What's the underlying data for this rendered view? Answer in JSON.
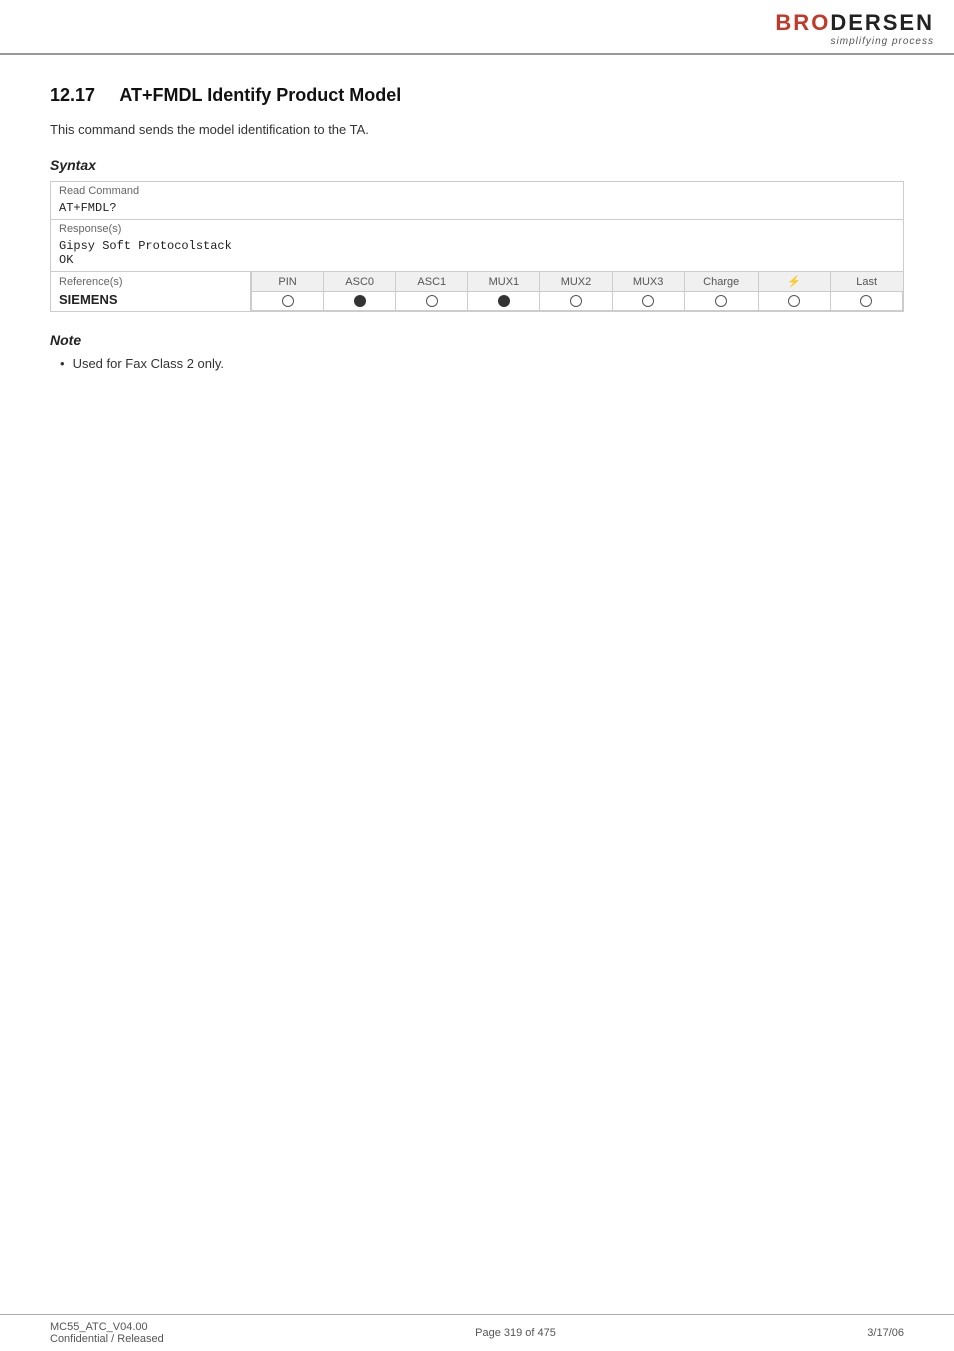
{
  "header": {
    "logo_text": "BRODERSEN",
    "logo_tagline": "simplifying process"
  },
  "section": {
    "number": "12.17",
    "title": "AT+FMDL   Identify Product Model",
    "description": "This command sends the model identification to the TA."
  },
  "syntax": {
    "label": "Syntax",
    "read_command_label": "Read Command",
    "read_command_value": "AT+FMDL?",
    "response_label": "Response(s)",
    "response_value": "Gipsy Soft Protocolstack\nOK",
    "reference_label": "Reference(s)",
    "columns": [
      "PIN",
      "ASC0",
      "ASC1",
      "MUX1",
      "MUX2",
      "MUX3",
      "Charge",
      "⚡",
      "Last"
    ],
    "rows": [
      {
        "name": "SIEMENS",
        "values": [
          "empty",
          "filled",
          "empty",
          "filled",
          "empty",
          "empty",
          "empty",
          "empty",
          "empty"
        ]
      }
    ]
  },
  "note": {
    "label": "Note",
    "items": [
      "Used for Fax Class 2 only."
    ]
  },
  "footer": {
    "left_line1": "MC55_ATC_V04.00",
    "left_line2": "Confidential / Released",
    "center": "Page 319 of 475",
    "right": "3/17/06"
  }
}
